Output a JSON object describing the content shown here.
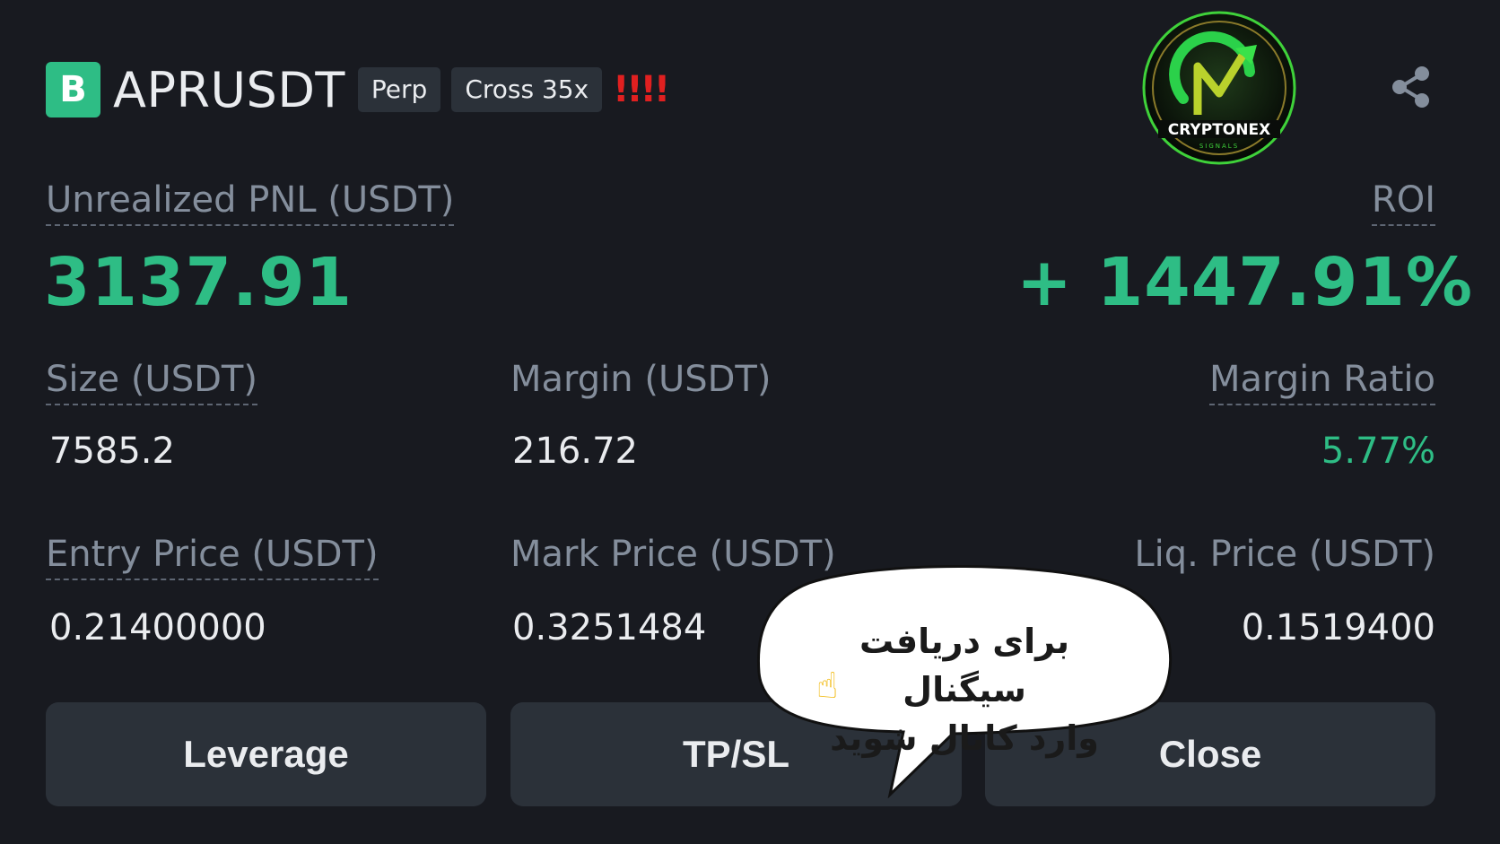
{
  "position": {
    "exchange_badge": "B",
    "symbol": "APRUSDT",
    "tag_type": "Perp",
    "tag_margin": "Cross 35x",
    "warning": "!!!!"
  },
  "logo": {
    "text": "CRYPTONEX",
    "subtext": "SIGNALS"
  },
  "pnl": {
    "label": "Unrealized PNL (USDT)",
    "value": "3137.91"
  },
  "roi": {
    "label": "ROI",
    "value": "+ 1447.91%"
  },
  "stats": {
    "size_label": "Size (USDT)",
    "size_value": "7585.2",
    "margin_label": "Margin (USDT)",
    "margin_value": "216.72",
    "margin_ratio_label": "Margin Ratio",
    "margin_ratio_value": "5.77%",
    "entry_label": "Entry Price (USDT)",
    "entry_value": "0.21400000",
    "mark_label": "Mark Price (USDT)",
    "mark_value": "0.3251484",
    "liq_label": "Liq. Price (USDT)",
    "liq_value": "0.1519400"
  },
  "buttons": {
    "leverage": "Leverage",
    "tpsl": "TP/SL",
    "close": "Close"
  },
  "overlay": {
    "line1": "برای دریافت سیگنال",
    "line2": "وارد کانال شوید"
  },
  "colors": {
    "background": "#181a20",
    "accent_green": "#2ebd85",
    "label_gray": "#848e9c",
    "button_bg": "#2b3139",
    "warning_red": "#e02020"
  }
}
